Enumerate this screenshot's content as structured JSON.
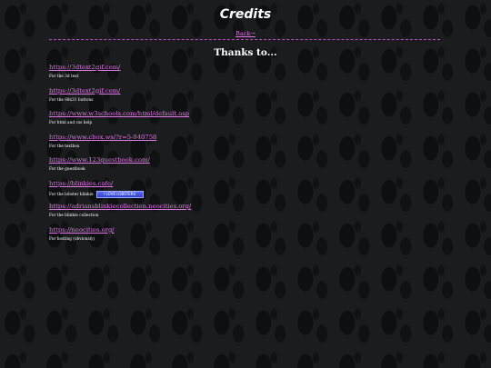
{
  "page": {
    "title": "Credits",
    "back_link": "Back→",
    "thanks_heading": "Thanks to..."
  },
  "credits": [
    {
      "url": "https://3dtext2gif.com/",
      "note": "For the 3d text"
    },
    {
      "url": "https://3dtext2gif.com/",
      "note": "For the 88x31 buttons"
    },
    {
      "url": "https://www.w3schools.com/html/default.asp",
      "note": "For html and css help"
    },
    {
      "url": "https://www.cbox.ws/?r=5-940758",
      "note": "For the textbox"
    },
    {
      "url": "https://www.123guestbook.com/",
      "note": "For the guestbook"
    },
    {
      "url": "https://blinkies.cafe/",
      "note": "For the lobster blinkie",
      "blinkie": "I LOVE LOBSTERS"
    },
    {
      "url": "https://adriansblinkiecollection.neocities.org/",
      "note": "For the blinkie collection"
    },
    {
      "url": "https://neocities.org/",
      "note": "For hosting (obviously)"
    }
  ],
  "colors": {
    "background": "#1a1c1e",
    "link": "#e07ae6",
    "divider": "#b54bbd",
    "text": "#ffffff"
  }
}
